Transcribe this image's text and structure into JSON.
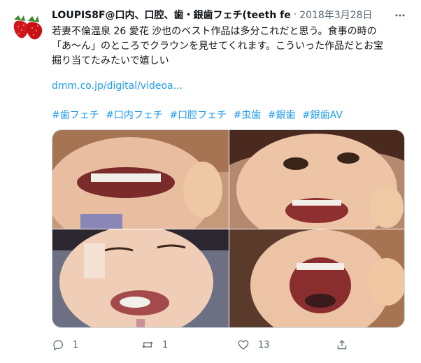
{
  "tweet": {
    "author_name": "LOUPIS8F@口内、口腔、歯・銀歯フェチ(teeth fe",
    "separator": "·",
    "date": "2018年3月28日",
    "text_lines": [
      "若妻不倫温泉 26 愛花 沙也のベスト作品は多分これだと思う。食事の時の",
      "「あ〜ん」のところでクラウンを見せてくれます。こういった作品だとお宝",
      "掘り当てたみたいで嬉しい"
    ],
    "link": "dmm.co.jp/digital/videoa...",
    "hashtags": [
      "#歯フェチ",
      "#口内フェチ",
      "#口腔フェチ",
      "#虫歯",
      "#銀歯",
      "#銀歯AV"
    ],
    "media": [
      {
        "icon": "photo-1"
      },
      {
        "icon": "photo-2"
      },
      {
        "icon": "photo-3"
      },
      {
        "icon": "photo-4"
      }
    ],
    "actions": {
      "reply_count": "1",
      "retweet_count": "1",
      "like_count": "13"
    }
  },
  "colors": {
    "accent": "#1d9bf0",
    "secondary_text": "#536471",
    "primary_text": "#0f1419"
  }
}
